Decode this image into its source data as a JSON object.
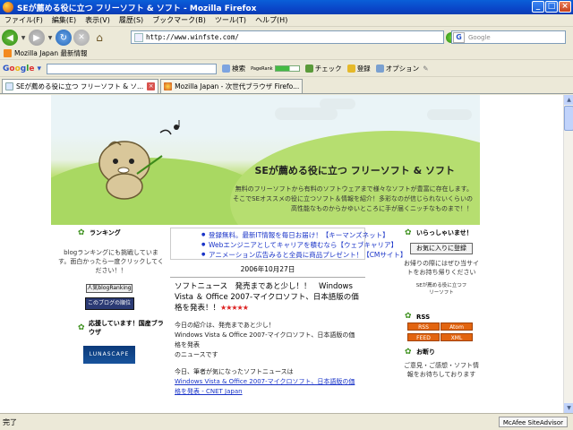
{
  "window": {
    "title": "SEが薦める役に立つ フリーソフト & ソフト - Mozilla Firefox",
    "minimize": "_",
    "maximize": "□",
    "close": "×"
  },
  "menu": [
    "ファイル(F)",
    "編集(E)",
    "表示(V)",
    "履歴(S)",
    "ブックマーク(B)",
    "ツール(T)",
    "ヘルプ(H)"
  ],
  "navbar": {
    "url": "http://www.winfste.com/",
    "search_placeholder": "Google"
  },
  "bookmarks": {
    "item": "Mozilla Japan 最新情報"
  },
  "google_toolbar": {
    "search_label": "検索",
    "pagerank_label": "PageRank",
    "check_label": "チェック",
    "bookmark_label": "登録",
    "options_label": "オプション"
  },
  "tabs": [
    {
      "label": "SEが薦める役に立つ フリーソフト & ソ..."
    },
    {
      "label": "Mozilla Japan - 次世代ブラウザ Firefo..."
    }
  ],
  "banner": {
    "site_title": "SEが薦める役に立つ フリーソフト & ソフト",
    "description": "無料のフリーソフトから有料のソフトウェアまで様々なソフトが豊富に存在します。そこでSEオススメの役に立つソフト＆情報を紹介！多彩なのが信じられないくらいの高性能なものからかゆいところに手が届くニッチなものまで！！"
  },
  "left": {
    "ranking_head": "ランキング",
    "ranking_text": "blogランキングにも挑戦しています。面白かったら一度クリックしてください！！",
    "blog_ranking_badge": "人気blogRanking",
    "blog_rank_badge": "このブログの順位は",
    "support_head": "応援しています！国産ブラウザ",
    "lunascape": "LUNASCAPE"
  },
  "center": {
    "ads": [
      "登録無料。最新IT情報を毎日お届け！【キーマンズネット】",
      "Webエンジニアとしてキャリアを積むなら【ウェブキャリア】",
      "アニメーション広告みると全員に商品プレゼント！【CMサイト】"
    ],
    "date": "2006年10月27日",
    "post_title": "ソフトニュース　発売まであと少し！！　Windows Vista ＆ Office 2007-マイクロソフト、日本語版の価格を発表！！",
    "stars": "★★★★★",
    "para1": "今日の紹介は、発売まであと少し！",
    "para1b": "Windows Vista & Office 2007-マイクロソフト、日本語版の価格を発表",
    "para1c": "のニュースです",
    "para2": "今日、筆者が気になったソフトニュースは",
    "link": "Windows Vista & Office 2007-マイクロソフト、日本語版の価格を発表 - CNET Japan"
  },
  "right": {
    "welcome_head": "いらっしゃいませ！",
    "favorite_button": "お気に入りに登録",
    "favorite_text": "お帰りの際にはぜひ当サイトをお持ち帰りください",
    "se_badge": "SEが薦める役に立つフリーソフト",
    "rss_head": "RSS",
    "rss_buttons": [
      "RSS",
      "Atom",
      "FEED",
      "XML"
    ],
    "notice_head": "お断り",
    "notice_text": "ご意見・ご感想・ソフト情報をお待ちしております"
  },
  "status": {
    "text": "完了",
    "mcafee": "McAfee SiteAdvisor"
  }
}
